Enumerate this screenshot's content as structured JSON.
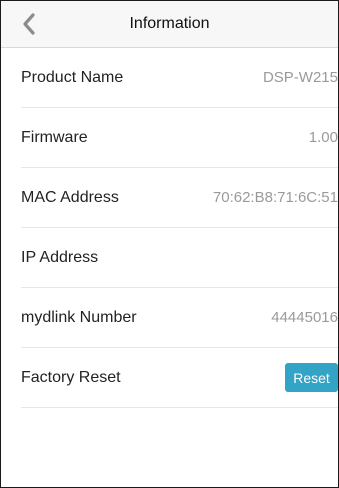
{
  "header": {
    "title": "Information",
    "back_icon": "chevron-left-icon"
  },
  "rows": [
    {
      "label": "Product Name",
      "value": "DSP-W215"
    },
    {
      "label": "Firmware",
      "value": "1.00"
    },
    {
      "label": "MAC Address",
      "value": "70:62:B8:71:6C:51"
    },
    {
      "label": "IP Address",
      "value": ""
    },
    {
      "label": "mydlink Number",
      "value": "44445016"
    },
    {
      "label": "Factory Reset",
      "button_label": "Reset"
    }
  ],
  "colors": {
    "accent": "#33a3c6",
    "value_text": "#9a9a9a",
    "chevron": "#8c8c8c"
  }
}
